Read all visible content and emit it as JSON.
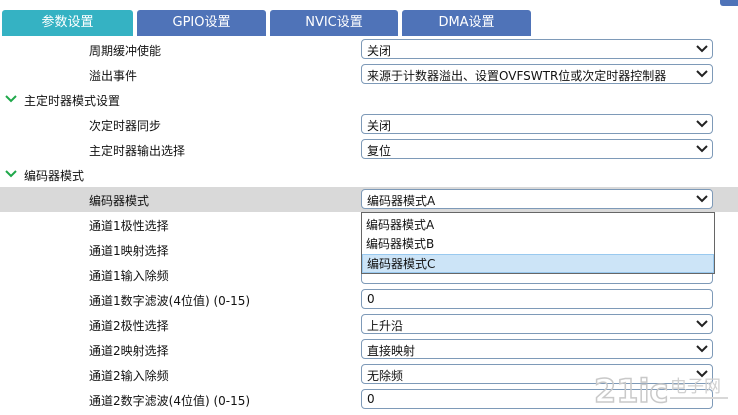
{
  "tabs": [
    {
      "label": "参数设置",
      "active": true
    },
    {
      "label": "GPIO设置",
      "active": false
    },
    {
      "label": "NVIC设置",
      "active": false
    },
    {
      "label": "DMA设置",
      "active": false
    }
  ],
  "rows": {
    "period_buffer": {
      "label": "周期缓冲使能",
      "value": "关闭"
    },
    "overflow_event": {
      "label": "溢出事件",
      "value": "来源于计数器溢出、设置OVFSWTR位或次定时器控制器"
    }
  },
  "section_master": {
    "title": "主定时器模式设置"
  },
  "rows_master": {
    "slave_sync": {
      "label": "次定时器同步",
      "value": "关闭"
    },
    "master_output": {
      "label": "主定时器输出选择",
      "value": "复位"
    }
  },
  "section_encoder": {
    "title": "编码器模式"
  },
  "rows_encoder": {
    "encoder_mode": {
      "label": "编码器模式",
      "value": "编码器模式A"
    },
    "ch1_polarity": {
      "label": "通道1极性选择"
    },
    "ch1_mapping": {
      "label": "通道1映射选择"
    },
    "ch1_prescaler": {
      "label": "通道1输入除频"
    },
    "ch1_filter": {
      "label": "通道1数字滤波(4位值) (0-15)",
      "value": "0"
    },
    "ch2_polarity": {
      "label": "通道2极性选择",
      "value": "上升沿"
    },
    "ch2_mapping": {
      "label": "通道2映射选择",
      "value": "直接映射"
    },
    "ch2_prescaler": {
      "label": "通道2输入除频",
      "value": "无除频"
    },
    "ch2_filter": {
      "label": "通道2数字滤波(4位值) (0-15)",
      "value": "0"
    }
  },
  "encoder_dropdown": {
    "options": [
      "编码器模式A",
      "编码器模式B",
      "编码器模式C"
    ],
    "hovered": "编码器模式C"
  },
  "colors": {
    "tab_active": "#35b2c3",
    "tab": "#4f73b8",
    "section_chevron": "#1fa84a",
    "row_highlight": "#d9d9d9"
  },
  "icons": {
    "select": "chevron-down-icon",
    "section": "section-expand-chevron-icon"
  },
  "watermark": {
    "text": "21ic电子网"
  }
}
